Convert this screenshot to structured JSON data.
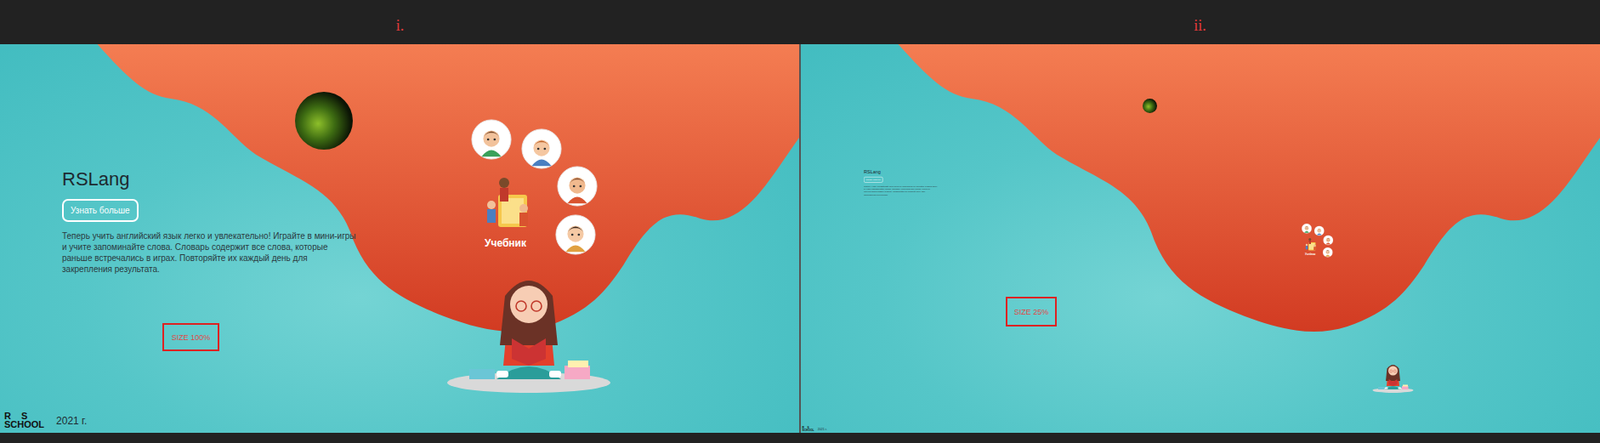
{
  "panels": [
    {
      "label": "i.",
      "kind": "full",
      "annotation": "SIZE 100%",
      "hero": {
        "title": "RSLang",
        "button": "Узнать больше",
        "text": "Теперь учить английский язык легко и увлекательно! Играйте в мини-игры и учите запоминайте слова. Словарь содержит все слова, которые раньше встречались в играх. Повторяйте их каждый день для закрепления результата."
      },
      "book_label": "Учебник",
      "footer": {
        "logo": [
          "R",
          "S",
          "SCHOOL"
        ],
        "year": "2021 г."
      }
    },
    {
      "label": "ii.",
      "kind": "small",
      "annotation": "SIZE 25%",
      "hero": {
        "title": "RSLang",
        "button": "Узнать больше",
        "text": "Теперь учить английский язык легко и увлекательно! Играйте в мини-игры и учите запоминайте слова. Словарь содержит все слова, которые раньше встречались в играх. Повторяйте их каждый день для закрепления результата."
      },
      "book_label": "Учебник",
      "footer": {
        "logo": [
          "R",
          "S",
          "SCHOOL"
        ],
        "year": "2021 г."
      }
    }
  ]
}
